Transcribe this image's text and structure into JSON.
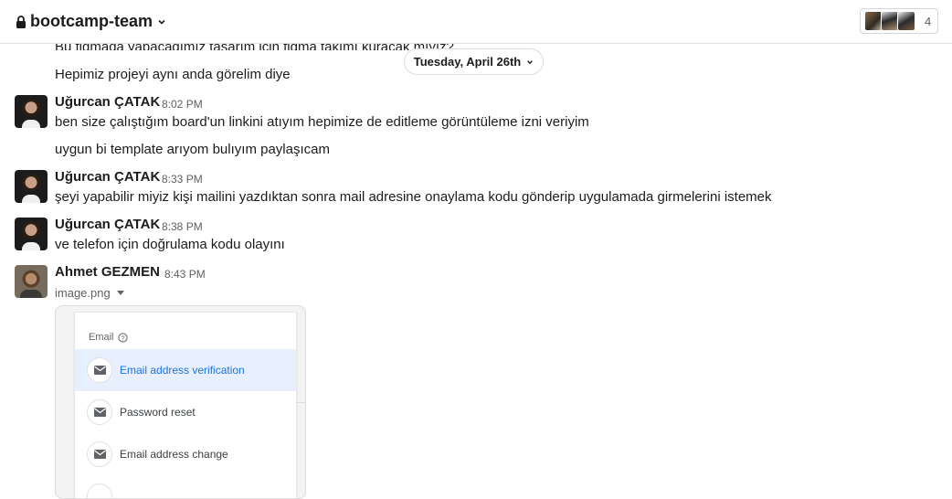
{
  "header": {
    "channel_name": "bootcamp-team",
    "member_count": "4"
  },
  "date_divider": "Tuesday, April 26th",
  "messages": {
    "cont1_clipped": "Bu figmada yapacağımız tasarım için figma takımı kuracak mıyız?",
    "cont2": "Hepimiz projeyi aynı anda görelim diye",
    "m1": {
      "sender": "Uğurcan ÇATAK",
      "time": "8:02 PM",
      "text": "ben size çalıştığım board'un linkini atıyım hepimize de editleme görüntüleme izni veriyim",
      "cont": "uygun bi template arıyom bulıyım paylaşıcam"
    },
    "m2": {
      "sender": "Uğurcan ÇATAK",
      "time": "8:33 PM",
      "text": "şeyi yapabilir miyiz kişi mailini yazdıktan sonra mail adresine onaylama kodu gönderip uygulamada girmelerini istemek"
    },
    "m3": {
      "sender": "Uğurcan ÇATAK",
      "time": "8:38 PM",
      "text": "ve telefon için doğrulama kodu olayını"
    },
    "m4": {
      "sender": "Ahmet GEZMEN",
      "time": "8:43 PM",
      "file_name": "image.png"
    }
  },
  "attachment": {
    "section_title": "Email",
    "items": [
      {
        "label": "Email address verification",
        "selected": true
      },
      {
        "label": "Password reset",
        "selected": false
      },
      {
        "label": "Email address change",
        "selected": false
      }
    ]
  }
}
